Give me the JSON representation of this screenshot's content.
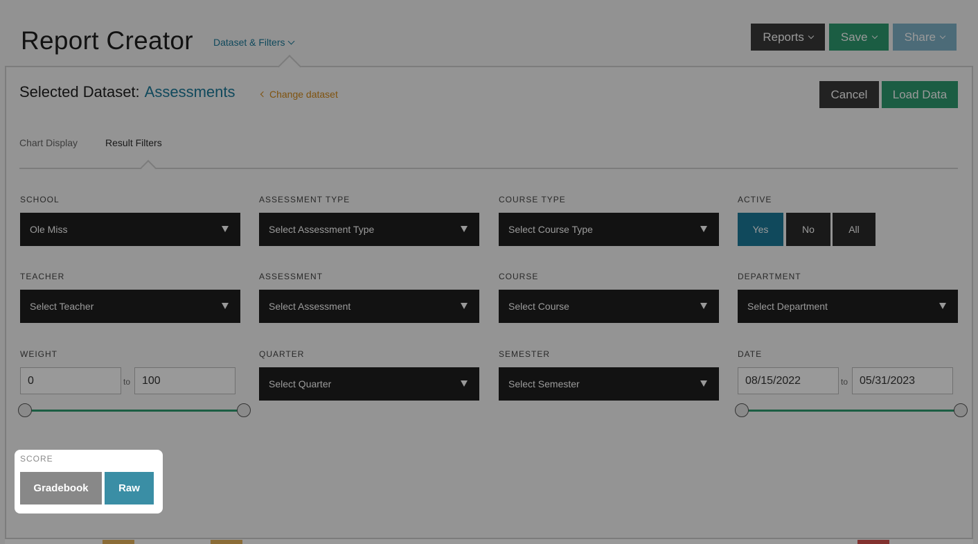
{
  "header": {
    "title": "Report Creator",
    "dataset_menu_label": "Dataset & Filters",
    "buttons": {
      "reports": "Reports",
      "save": "Save",
      "share": "Share"
    }
  },
  "dataset": {
    "prefix": "Selected Dataset:",
    "name": "Assessments",
    "change_label": "Change dataset",
    "cancel_label": "Cancel",
    "load_label": "Load Data"
  },
  "tabs": [
    {
      "label": "Chart Display",
      "active": false
    },
    {
      "label": "Result Filters",
      "active": true
    }
  ],
  "filters": {
    "school": {
      "label": "SCHOOL",
      "value": "Ole Miss"
    },
    "assessment_type": {
      "label": "ASSESSMENT TYPE",
      "value": "Select Assessment Type"
    },
    "course_type": {
      "label": "COURSE TYPE",
      "value": "Select Course Type"
    },
    "active": {
      "label": "ACTIVE",
      "options": [
        "Yes",
        "No",
        "All"
      ],
      "selected": "Yes"
    },
    "teacher": {
      "label": "TEACHER",
      "value": "Select Teacher"
    },
    "assessment": {
      "label": "ASSESSMENT",
      "value": "Select Assessment"
    },
    "course": {
      "label": "COURSE",
      "value": "Select Course"
    },
    "department": {
      "label": "DEPARTMENT",
      "value": "Select Department"
    },
    "weight": {
      "label": "WEIGHT",
      "min": "0",
      "max": "100",
      "to_label": "to"
    },
    "quarter": {
      "label": "QUARTER",
      "value": "Select Quarter"
    },
    "semester": {
      "label": "SEMESTER",
      "value": "Select Semester"
    },
    "date": {
      "label": "DATE",
      "start": "08/15/2022",
      "end": "05/31/2023",
      "to_label": "to"
    },
    "score": {
      "label": "SCORE",
      "options": [
        "Gradebook",
        "Raw"
      ],
      "selected": "Raw"
    }
  },
  "colors": {
    "accent_blue": "#1c7a9a",
    "accent_green": "#2e9b70",
    "accent_orange": "#d48a19",
    "dark_button": "#1f1f1f"
  }
}
